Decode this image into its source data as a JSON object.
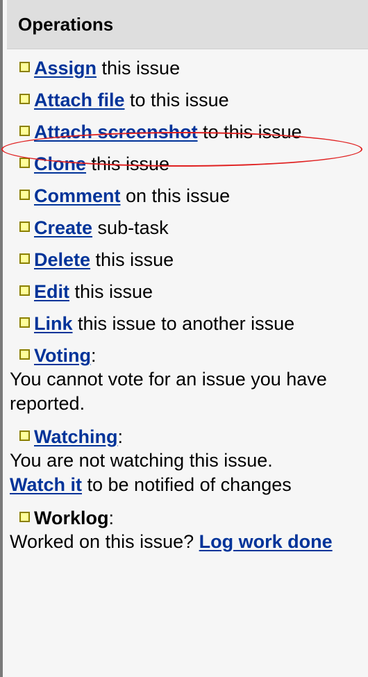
{
  "header": {
    "title": "Operations"
  },
  "operations": [
    {
      "link": "Assign",
      "rest": " this issue"
    },
    {
      "link": "Attach file",
      "rest": " to this issue"
    },
    {
      "link": "Attach screenshot",
      "rest": " to this issue"
    },
    {
      "link": "Clone",
      "rest": " this issue"
    },
    {
      "link": "Comment",
      "rest": " on this issue"
    },
    {
      "link": "Create",
      "rest": " sub-task"
    },
    {
      "link": "Delete",
      "rest": " this issue"
    },
    {
      "link": "Edit",
      "rest": " this issue"
    },
    {
      "link": "Link",
      "rest": " this issue to another issue"
    }
  ],
  "voting": {
    "label": "Voting",
    "colon": ":",
    "text": "You cannot vote for an issue you have reported."
  },
  "watching": {
    "label": "Watching",
    "colon": ":",
    "text": "You are not watching this issue.",
    "watch_link": "Watch it",
    "watch_rest": " to be notified of changes"
  },
  "worklog": {
    "label": "Worklog",
    "colon": ":",
    "text": "Worked on this issue? ",
    "log_link": "Log work done"
  },
  "colors": {
    "link": "#003399",
    "header_bg": "#dedede",
    "bullet_fill": "#ffff9a",
    "bullet_border": "#8b8000",
    "highlight": "#e02020"
  }
}
